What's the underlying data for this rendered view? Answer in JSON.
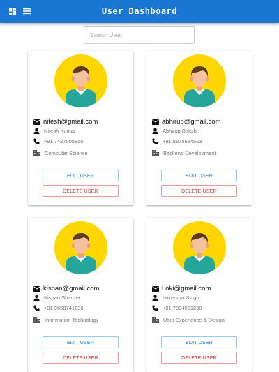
{
  "header": {
    "title": "User Dashboard",
    "left_icon": "dashboard-icon",
    "menu_icon": "menu-icon",
    "bar_color": "#1976d2"
  },
  "search": {
    "placeholder": "Search User",
    "value": ""
  },
  "buttons": {
    "edit_label": "EDIT USER",
    "delete_label": "DELETE USER"
  },
  "users": [
    {
      "email": "nitesh@gmail.com",
      "name": "Nitesh Kumar",
      "phone": "+91 7427006856",
      "department": "Computer Science"
    },
    {
      "email": "abhirup@gmail.com",
      "name": "Abhirup Bakshi",
      "phone": "+91 8875694523",
      "department": "Backend Development"
    },
    {
      "email": "kishan@gmail.com",
      "name": "Kishan Sharma",
      "phone": "+91 9658741236",
      "department": "Information Technology"
    },
    {
      "email": "Loki@gmail.com",
      "name": "Lokendra Singh",
      "phone": "+91 7894561230",
      "department": "User Experience & Design"
    }
  ],
  "colors": {
    "avatar_bg": "#ffd600",
    "shirt": "#26a69a",
    "edit": "#1976d2",
    "delete": "#d32f2f"
  }
}
